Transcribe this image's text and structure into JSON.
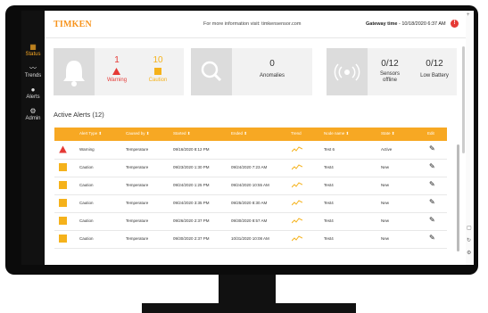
{
  "app": {
    "logo": "TIMKEN",
    "info_text": "For more information visit: timkensensor.com",
    "gateway_label": "Gateway time",
    "gateway_time": "- 10/18/2020 6:37 AM",
    "notification_count": "!"
  },
  "sidebar": {
    "items": [
      {
        "label": "Status",
        "icon": "grid-icon"
      },
      {
        "label": "Trends",
        "icon": "trend-icon"
      },
      {
        "label": "Alerts",
        "icon": "alert-icon"
      },
      {
        "label": "Admin",
        "icon": "admin-icon"
      }
    ]
  },
  "summary": {
    "alerts": {
      "warning_count": "1",
      "warning_label": "Warning",
      "caution_count": "10",
      "caution_label": "Caution"
    },
    "anomalies": {
      "count": "0",
      "label": "Anomalies"
    },
    "sensors": {
      "offline_count": "0/12",
      "offline_label1": "Sensors",
      "offline_label2": "offline",
      "battery_count": "0/12",
      "battery_label": "Low Battery"
    }
  },
  "section_title": "Active Alerts (12)",
  "table": {
    "headers": [
      "Alert Type ⬍",
      "Caused by ⬍",
      "Started ⬍",
      "Ended ⬍",
      "Trend",
      "Node name ⬍",
      "State ⬍",
      "Edit"
    ],
    "rows": [
      {
        "type": "Warning",
        "caused": "Temperature",
        "started": "09/16/2020 8:12 PM",
        "ended": "",
        "node": "Test 6",
        "state": "Active"
      },
      {
        "type": "Caution",
        "caused": "Temperature",
        "started": "09/23/2020 1:30 PM",
        "ended": "09/24/2020 7:23 AM",
        "node": "Test4",
        "state": "New"
      },
      {
        "type": "Caution",
        "caused": "Temperature",
        "started": "09/24/2020 1:25 PM",
        "ended": "09/24/2020 10:55 AM",
        "node": "Test4",
        "state": "New"
      },
      {
        "type": "Caution",
        "caused": "Temperature",
        "started": "09/24/2020 3:35 PM",
        "ended": "09/25/2020 8:30 AM",
        "node": "Test4",
        "state": "New"
      },
      {
        "type": "Caution",
        "caused": "Temperature",
        "started": "09/26/2020 2:37 PM",
        "ended": "09/30/2020 8:57 AM",
        "node": "Test4",
        "state": "New"
      },
      {
        "type": "Caution",
        "caused": "Temperature",
        "started": "09/30/2020 2:37 PM",
        "ended": "10/31/2020 10:08 AM",
        "node": "Test4",
        "state": "New"
      }
    ]
  },
  "colors": {
    "accent": "#f7a823",
    "warning": "#e53935",
    "caution": "#f5b21b",
    "sidebar": "#111111"
  }
}
